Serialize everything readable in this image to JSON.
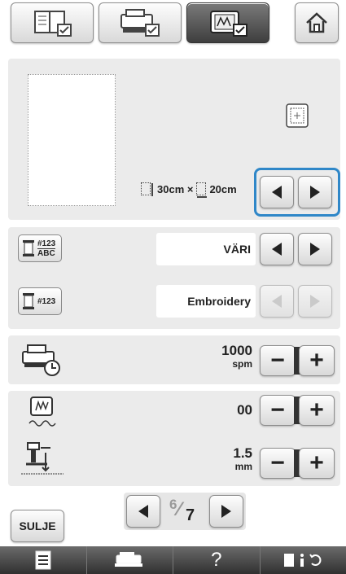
{
  "top_tabs": [
    {
      "name": "utility-settings-tab",
      "icon": "utility-settings-icon"
    },
    {
      "name": "general-settings-tab",
      "icon": "general-settings-icon"
    },
    {
      "name": "embroidery-settings-tab",
      "icon": "embroidery-settings-icon"
    }
  ],
  "home_button": {
    "icon": "home-icon"
  },
  "frame_section": {
    "frame_size_text": "30cm × ",
    "frame_width_text": "20cm"
  },
  "thread_display": {
    "value": "VÄRI",
    "icon": "thread-color-number-icon",
    "icon_line1": "#123",
    "icon_line2": "ABC"
  },
  "thread_number": {
    "value": "Embroidery",
    "icon": "thread-brand-icon",
    "icon_label": "#123"
  },
  "speed": {
    "value": "1000",
    "unit": "spm"
  },
  "frame_offset": {
    "value": "00"
  },
  "foot_height": {
    "value": "1.5",
    "unit": "mm"
  },
  "pagination": {
    "current": "6",
    "total": "7"
  },
  "close_button": {
    "label": "SULJE"
  },
  "bottom_bar": {
    "help": "?"
  },
  "colors": {
    "highlight": "#2f87c8",
    "panel": "#ebebeb"
  }
}
